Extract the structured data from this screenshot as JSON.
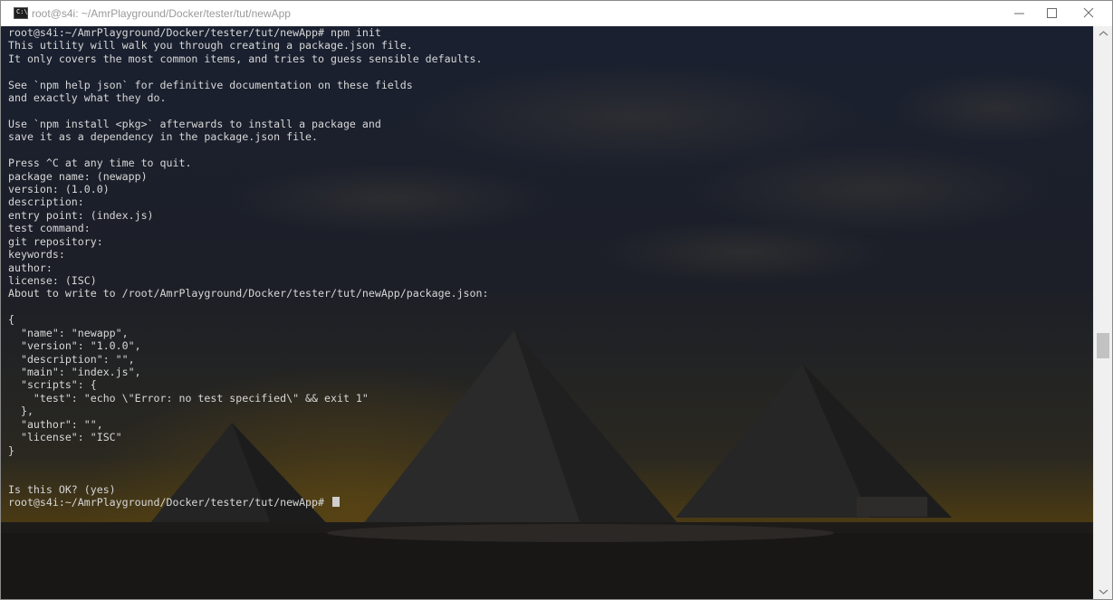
{
  "window": {
    "title": "root@s4i: ~/AmrPlayground/Docker/tester/tut/newApp",
    "icon": "console-icon",
    "icon_glyph": "C:\\"
  },
  "controls": {
    "minimize": "minimize-icon",
    "maximize": "maximize-icon",
    "close": "close-icon"
  },
  "terminal": {
    "background_colors": {
      "sky_top": "#1a2030",
      "sky_horizon": "#4a3a14",
      "pyramids": "#262626",
      "ground": "#1e1c1b"
    },
    "lines": [
      "root@s4i:~/AmrPlayground/Docker/tester/tut/newApp# npm init",
      "This utility will walk you through creating a package.json file.",
      "It only covers the most common items, and tries to guess sensible defaults.",
      "",
      "See `npm help json` for definitive documentation on these fields",
      "and exactly what they do.",
      "",
      "Use `npm install <pkg>` afterwards to install a package and",
      "save it as a dependency in the package.json file.",
      "",
      "Press ^C at any time to quit.",
      "package name: (newapp)",
      "version: (1.0.0)",
      "description:",
      "entry point: (index.js)",
      "test command:",
      "git repository:",
      "keywords:",
      "author:",
      "license: (ISC)",
      "About to write to /root/AmrPlayground/Docker/tester/tut/newApp/package.json:",
      "",
      "{",
      "  \"name\": \"newapp\",",
      "  \"version\": \"1.0.0\",",
      "  \"description\": \"\",",
      "  \"main\": \"index.js\",",
      "  \"scripts\": {",
      "    \"test\": \"echo \\\"Error: no test specified\\\" && exit 1\"",
      "  },",
      "  \"author\": \"\",",
      "  \"license\": \"ISC\"",
      "}",
      "",
      "",
      "Is this OK? (yes)",
      "root@s4i:~/AmrPlayground/Docker/tester/tut/newApp#"
    ]
  },
  "scrollbar": {
    "up_icon": "scroll-up-arrow-icon",
    "down_icon": "scroll-down-arrow-icon"
  }
}
